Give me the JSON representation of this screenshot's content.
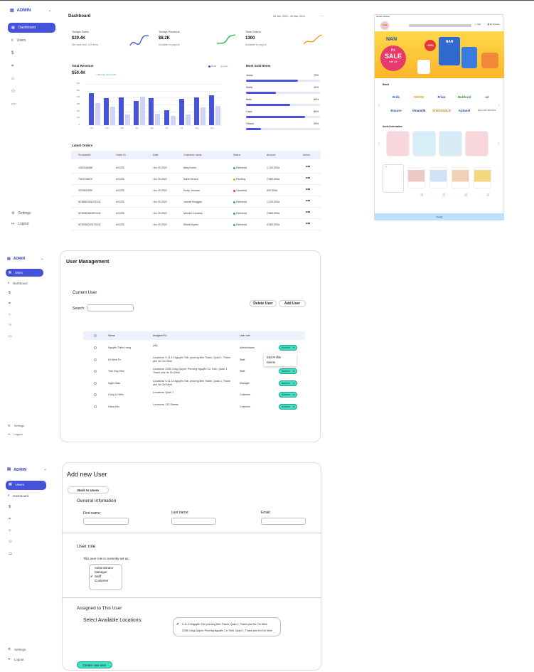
{
  "colors": {
    "accent": "#4552d9",
    "teal": "#3fe0c5",
    "delivered": "#2fb54a",
    "pending": "#f59c1a",
    "canceled": "#e53935"
  },
  "s1": {
    "sidebar": {
      "brand": "ADMIN",
      "items": [
        {
          "label": "Dashboard",
          "icon": "grid-icon"
        },
        {
          "label": "Users",
          "icon": "bar-icon"
        },
        {
          "label": "",
          "icon": "dollar-icon"
        },
        {
          "label": "",
          "icon": "tag-icon"
        },
        {
          "label": "",
          "icon": "bag-icon"
        },
        {
          "label": "",
          "icon": "people-icon"
        },
        {
          "label": "",
          "icon": "chat-icon"
        }
      ],
      "settings": "Settings",
      "logout": "Logout"
    },
    "title": "Dashboard",
    "daterange": "26 Jan, 2024 - 26 Mar, 2024",
    "cards": [
      {
        "title": "Todays Sales",
        "value": "$20.4K",
        "sub": "We have sold 123 items"
      },
      {
        "title": "Todays Revenue",
        "value": "$8.2K",
        "sub": "Available to payout"
      },
      {
        "title": "Total Orders",
        "value": "1300",
        "sub": "Available to payout"
      }
    ],
    "revenue": {
      "title": "Total Revenue",
      "value": "$50.4K",
      "change": "5% than last month",
      "legend": [
        "Profit",
        "Loss"
      ]
    },
    "sold": {
      "title": "Most Sold Items",
      "items": [
        {
          "name": "Jeans",
          "pct": "70%",
          "v": 0.7
        },
        {
          "name": "Shirts",
          "pct": "40%",
          "v": 0.4
        },
        {
          "name": "Belts",
          "pct": "60%",
          "v": 0.6
        },
        {
          "name": "Caps",
          "pct": "80%",
          "v": 0.8
        },
        {
          "name": "Others",
          "pct": "20%",
          "v": 0.2
        }
      ]
    },
    "orders": {
      "title": "Latest Orders",
      "headers": [
        "ProductsID",
        "Order ID",
        "Date",
        "Customer name",
        "Status",
        "Amount",
        "Action"
      ],
      "rows": [
        [
          "1362346986",
          "#11232",
          "Jun 29,2022",
          "Afaq Karim",
          "Delivered",
          "1,100,000d"
        ],
        [
          "7323739979",
          "#11232",
          "Jun 29,2022",
          "Karim Benza",
          "Pending",
          "2,980,000d"
        ],
        [
          "2224641859",
          "#11232",
          "Jun 29,2022",
          "Emily Johnson",
          "Canceled",
          "500,000d"
        ],
        [
          "AF8B6D2514F2441",
          "#11232",
          "Jun 29,2022",
          "Janelle Bruggen",
          "Delivered",
          "1,200,000d"
        ],
        [
          "AF0E8D0609F2441",
          "#11232",
          "Jun 29,2022",
          "Mendel Conachy",
          "Delivered",
          "2,660,000d"
        ],
        [
          "AF0E8D0201F3441",
          "#11232",
          "Jun 29,2022",
          "Elliott Dryden",
          "Delivered",
          "4,960,000d"
        ]
      ]
    }
  },
  "chart_data": {
    "type": "bar",
    "categories": [
      "Jan",
      "Feb",
      "Mar",
      "Apr",
      "May",
      "Jun",
      "Jul",
      "Aug",
      "Sep"
    ],
    "series": [
      {
        "name": "Profit",
        "values": [
          470,
          390,
          400,
          350,
          390,
          220,
          380,
          400,
          430
        ]
      },
      {
        "name": "Loss",
        "values": [
          320,
          270,
          160,
          410,
          170,
          130,
          160,
          260,
          280
        ]
      }
    ],
    "ylim": [
      0,
      600
    ],
    "yticks": [
      "600",
      "500",
      "400",
      "300",
      "200",
      "100",
      "0"
    ]
  },
  "s2": {
    "sidebar": {
      "brand": "ADMIN",
      "items": [
        "Users",
        "Dashboard"
      ],
      "settings": "Settings",
      "logout": "Logout"
    },
    "title": "User Management",
    "section": "Current User",
    "search_label": "Search:",
    "delete_btn": "Delete User",
    "add_btn": "Add User",
    "headers": [
      "Name",
      "Assigned To",
      "User role"
    ],
    "rows": [
      [
        "Nguyễn Thiên Hưng",
        "(All)",
        "Administrator"
      ],
      [
        "Lê Minh Trí",
        "Locations: 9-11-13 Nguyễn Trãi, phường Bến Thành, Quận 1, Thành phố Hồ Chí Minh",
        "Staff"
      ],
      [
        "Trần Duy Khôi",
        "Locations: 223B Cộng Quỳnh, Phường Nguyễn Cư Trinh, Quận 1, Thành phố Hồ Chí Minh",
        "Staff"
      ],
      [
        "Ngân Giầu",
        "Locations: 9-11-13 Nguyễn Trãi, phường Bến Thành, Quận 1, Thành phố Hồ Chí Minh",
        "Manager"
      ],
      [
        "Cộng Lê Hiếu",
        "Locations: Quận 7",
        "Customer"
      ],
      [
        "Hana Kim",
        "Locations: 123 Streets",
        "Customer"
      ]
    ],
    "actions": "Actions",
    "menu": [
      "Edit Profile",
      "Delete"
    ]
  },
  "s3": {
    "sidebar": {
      "brand": "ADMIN",
      "items": [
        "Users",
        "Dashboard"
      ],
      "settings": "Settings",
      "logout": "Logout"
    },
    "title": "Add new User",
    "back": "Back to Users",
    "general": "General Infomation",
    "first": "First name:",
    "last": "Last name:",
    "email": "Email:",
    "role_title": "User role",
    "role_text": "This user role is currently set as:",
    "roles": [
      "Administrator",
      "Manager",
      "Staff",
      "Customer"
    ],
    "assign_title": "Assigned to This User",
    "select_loc": "Select Available Locations:",
    "locations": [
      "9-11-13 Nguyễn Trãi, phường Bến Thành, Quận 1, Thành phố Hồ Chí Minh",
      "223B Cộng Quỳnh, Phường Nguyễn Cư Trinh, Quận 1, Thành phố Hồ Chí Minh"
    ],
    "create": "Create new user"
  },
  "shop": {
    "header": "Nutrition Website",
    "logo": "YOUR LOGO",
    "cart": "Cart",
    "account": "My Account",
    "banner": [
      "NAN",
      "Hè",
      "SALE",
      "hết cỡ",
      "-10%",
      "NAN"
    ],
    "brand_title": "Brand",
    "brands": [
      "Enfa",
      "GROW",
      "Friso",
      "Nutifood",
      "a2",
      "Ensure",
      "Vinamilk",
      "YOKOGOLD",
      "Aptamil",
      "BELLAMY ORGANIC"
    ],
    "useful": "Useful information",
    "footer": "Footer"
  }
}
